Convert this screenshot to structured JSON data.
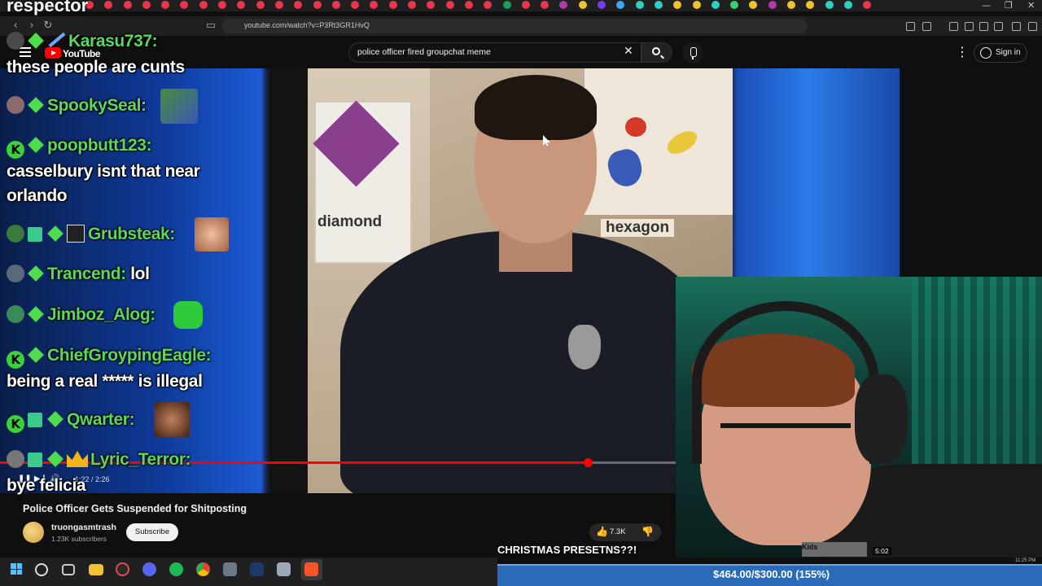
{
  "browser": {
    "url": "youtube.com/watch?v=P3Rt3GR1HvQ",
    "window_controls": [
      "—",
      "❐",
      "✕"
    ],
    "tab_icon_colors": [
      "#e8364b",
      "#e8364b",
      "#e8364b",
      "#e8364b",
      "#e8364b",
      "#e8364b",
      "#e8364b",
      "#e8364b",
      "#e8364b",
      "#e8364b",
      "#e8364b",
      "#e8364b",
      "#e8364b",
      "#e8364b",
      "#e8364b",
      "#e8364b",
      "#e8364b",
      "#e8364b",
      "#e8364b",
      "#e8364b",
      "#e8364b",
      "#e8364b",
      "#1a9e52",
      "#e8364b",
      "#e8364b",
      "#b03aa8",
      "#f2c230",
      "#7b3af0",
      "#3aa8f2",
      "#2fd0c0",
      "#2fd0c0",
      "#f2c230",
      "#f2c230",
      "#2fd0c0",
      "#3ad070",
      "#f2c230",
      "#b03aa8",
      "#f2c230",
      "#f2c230",
      "#2fd0c0",
      "#2fd0c0",
      "#e8364b"
    ]
  },
  "youtube": {
    "logo_text": "YouTube",
    "search_value": "police officer fired groupchat meme",
    "sign_in_label": "Sign in"
  },
  "player": {
    "time": "1:22 / 2:26",
    "progress_fraction": 0.87,
    "frame_labels": {
      "diamond": "diamond",
      "hexagon": "hexagon"
    }
  },
  "chat": {
    "top_name": "respector",
    "messages": [
      {
        "user": "Karasu737:",
        "text": "these people are cunts"
      },
      {
        "user": "SpookySeal:",
        "text": ""
      },
      {
        "user": "poopbutt123:",
        "text": "casselbury isnt that near",
        "text2": "orlando"
      },
      {
        "user": "Grubsteak:",
        "text": ""
      },
      {
        "user": "Trancend:",
        "text": "lol"
      },
      {
        "user": "Jimboz_Alog:",
        "text": ""
      },
      {
        "user": "ChiefGroypingEagle:",
        "text": "being a real ***** is illegal"
      },
      {
        "user": "Qwarter:",
        "text": ""
      },
      {
        "user": "Lyric_Terror:",
        "text": "bye felicia"
      }
    ],
    "mod_badge_glyph": "K"
  },
  "video": {
    "title": "Police Officer Gets Suspended for Shitposting",
    "channel": "truongasmtrash",
    "subscribers": "1.23K subscribers",
    "subscribe_label": "Subscribe",
    "likes": "7.3K"
  },
  "stream_overlay": {
    "title": "CHRISTMAS PRESETNS??!",
    "goal_text": "$464.00/$300.00 (155%)",
    "cam_timer": "5:02",
    "kids_label": "Kids",
    "clock": "11:25 PM"
  },
  "colors": {
    "chat_username": "#5dd65d",
    "progress": "#ff0000",
    "goal_bar": "#2b6ab8"
  },
  "icons": {
    "like": "👍",
    "dislike": "👎",
    "close": "✕",
    "kebab": "⋮"
  }
}
